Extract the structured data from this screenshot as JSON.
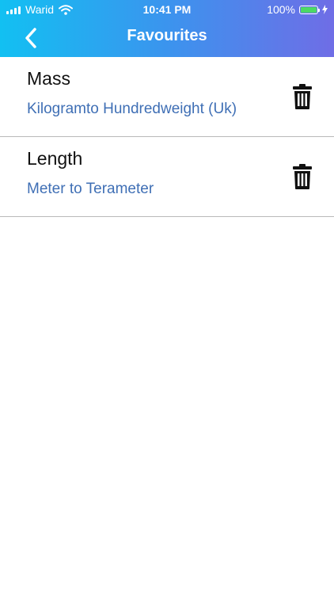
{
  "status_bar": {
    "carrier": "Warid",
    "time": "10:41 PM",
    "battery": "100%"
  },
  "header": {
    "title": "Favourites",
    "gradient_colors": [
      "#12c0f2",
      "#3b94ee",
      "#6f6de6"
    ]
  },
  "favourites": [
    {
      "category": "Mass",
      "conversion": "Kilogramto Hundredweight (Uk)"
    },
    {
      "category": "Length",
      "conversion": "Meter to Terameter"
    }
  ],
  "colors": {
    "subtitle": "#3f6fb5",
    "divider": "#b9b9b9",
    "battery_fill": "#4cd964"
  },
  "icons": {
    "back": "chevron-left-icon",
    "delete": "trash-icon"
  }
}
